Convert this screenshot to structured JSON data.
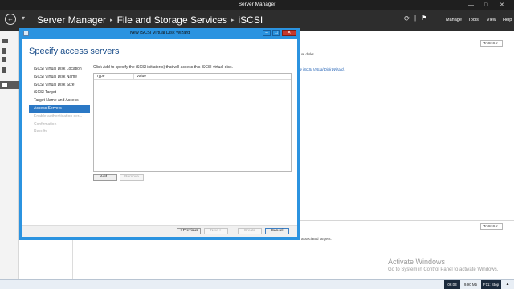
{
  "server_manager": {
    "window_title": "Server Manager",
    "breadcrumb": [
      "Server Manager",
      "File and Storage Services",
      "iSCSI"
    ],
    "menu": [
      "Manage",
      "Tools",
      "View",
      "Help"
    ],
    "tasks_label": "TASKS",
    "top_pane_text_1": "tual disks.",
    "top_pane_link": "ew iSCSI Virtual Disk Wizard.",
    "bottom_pane_text": "associated targets."
  },
  "wizard": {
    "title": "New iSCSI Virtual Disk Wizard",
    "heading": "Specify access servers",
    "steps": [
      {
        "label": "iSCSI Virtual Disk Location",
        "state": "normal"
      },
      {
        "label": "iSCSI Virtual Disk Name",
        "state": "normal"
      },
      {
        "label": "iSCSI Virtual Disk Size",
        "state": "normal"
      },
      {
        "label": "iSCSI Target",
        "state": "normal"
      },
      {
        "label": "Target Name and Access",
        "state": "normal"
      },
      {
        "label": "Access Servers",
        "state": "active"
      },
      {
        "label": "Enable authentication ser...",
        "state": "disabled"
      },
      {
        "label": "Confirmation",
        "state": "disabled"
      },
      {
        "label": "Results",
        "state": "disabled"
      }
    ],
    "instruction": "Click Add to specify the iSCSI initiator(s) that will access this iSCSI virtual disk.",
    "table_columns": [
      "Type",
      "Value"
    ],
    "add_button": "Add...",
    "remove_button": "Remove",
    "footer_buttons": {
      "previous": "< Previous",
      "next": "Next >",
      "create": "Create",
      "cancel": "Cancel"
    }
  },
  "activation": {
    "line1": "Activate Windows",
    "line2": "Go to System in Control Panel to activate Windows."
  },
  "taskbar": {
    "time": "06:03",
    "memory": "9.90 Mb",
    "stop_label": "F11: Stop"
  },
  "colors": {
    "wizard_frame": "#2b93e0",
    "active_step": "#2b78c5",
    "header_bg": "#2d2d2d",
    "heading_text": "#1b4e8a"
  },
  "icons": [
    "back-arrow-icon",
    "forward-arrow-icon",
    "refresh-icon",
    "flag-icon",
    "wizard-app-icon"
  ]
}
